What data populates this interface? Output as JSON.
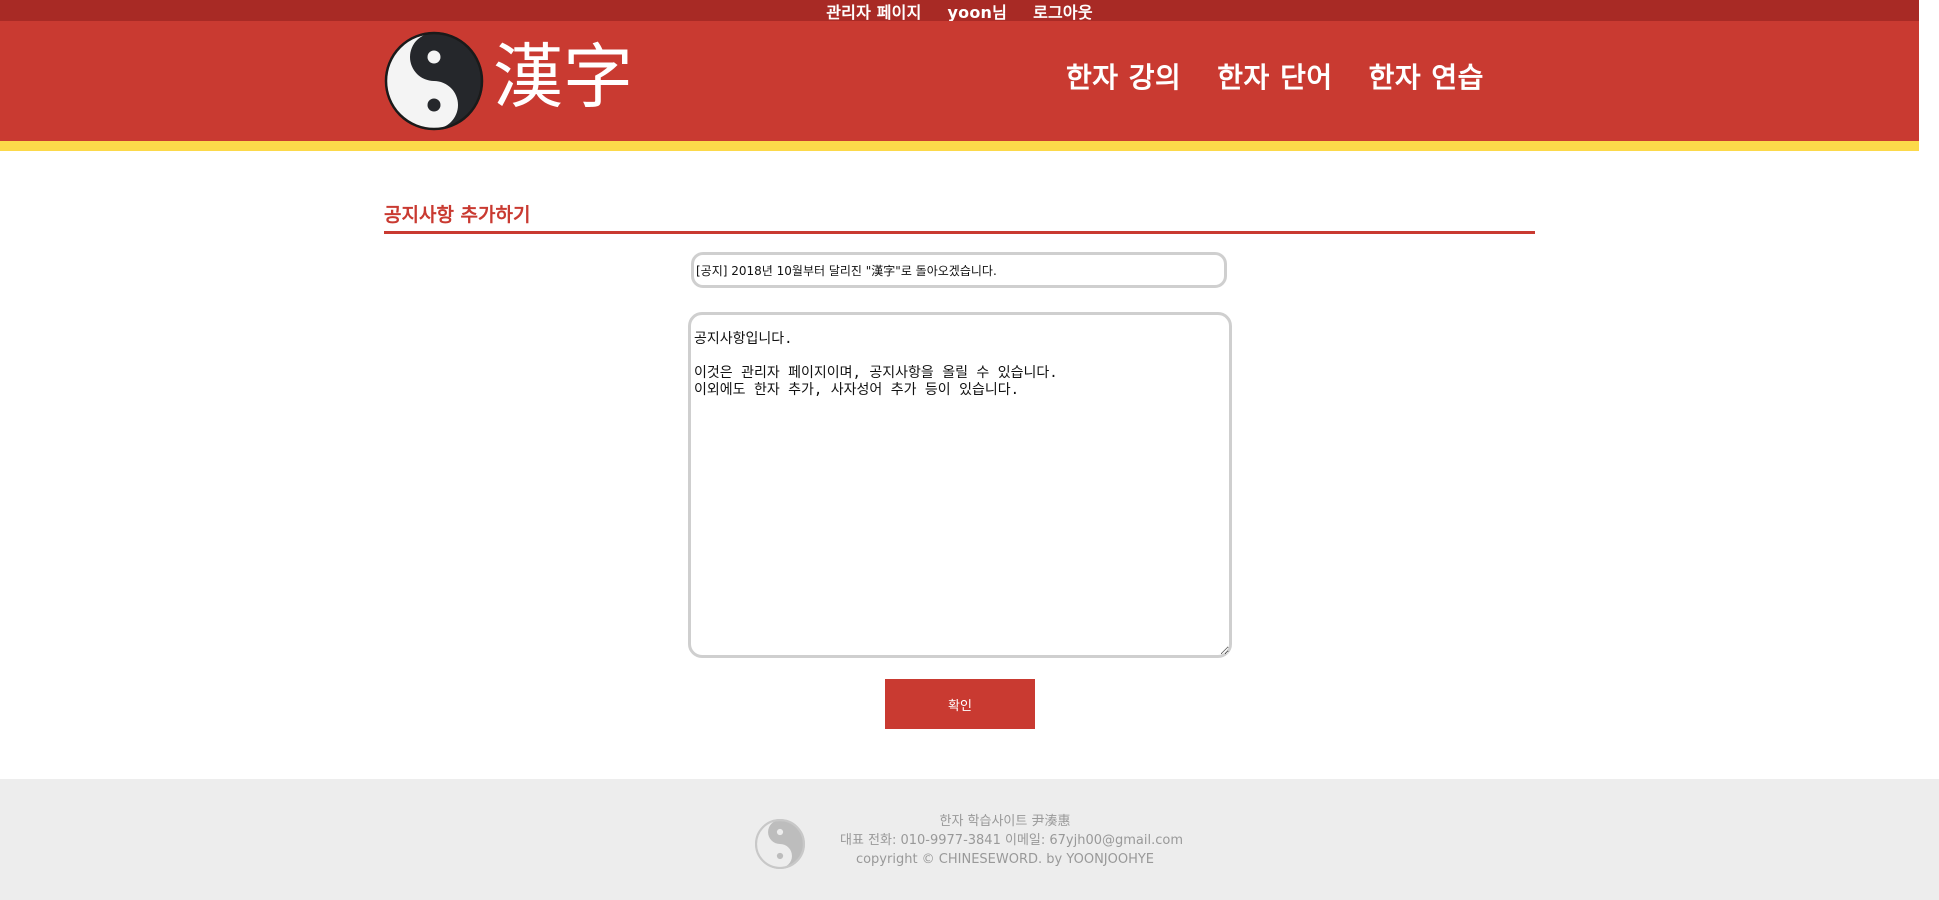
{
  "topbar": {
    "admin_link": "관리자 페이지",
    "user_greeting": "yoon님",
    "logout_link": "로그아웃"
  },
  "header": {
    "logo_text": "漢字",
    "nav": [
      {
        "label": "한자 강의"
      },
      {
        "label": "한자 단어"
      },
      {
        "label": "한자 연습"
      }
    ]
  },
  "main": {
    "section_title": "공지사항 추가하기",
    "title_value": "[공지] 2018년 10월부터 달리진 \"漢字\"로 돌아오겠습니다.",
    "body_value": "공지사항입니다.\n\n이것은 관리자 페이지이며, 공지사항을 올릴 수 있습니다.\n이외에도 한자 추가, 사자성어 추가 등이 있습니다.",
    "confirm_label": "확인"
  },
  "footer": {
    "line1": "한자 학습사이트 尹湊惠",
    "line2": "대표 전화: 010-9977-3841 이메일: 67yjh00@gmail.com",
    "line3": "copyright © CHINESEWORD. by YOONJOOHYE"
  },
  "colors": {
    "topbar": "#a82a25",
    "header": "#c93a31",
    "accent_stripe": "#fcd94a",
    "footer_bg": "#ededed",
    "footer_text": "#999999"
  }
}
